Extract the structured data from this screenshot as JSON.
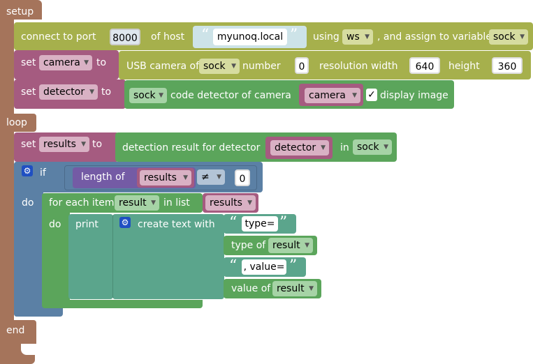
{
  "setup": {
    "label": "setup",
    "connect": {
      "prefix": "connect to port",
      "port": "8000",
      "of_host": "of host",
      "host": "myunoq.local",
      "using": "using",
      "protocol": "ws",
      "assign": ", and assign to variable",
      "variable": "sock"
    },
    "set_camera": {
      "set": "set",
      "var": "camera",
      "to": "to",
      "usb_camera_of": "USB camera of",
      "sock": "sock",
      "number": "number",
      "number_value": "0",
      "resolution_width": "resolution width",
      "width_value": "640",
      "height": "height",
      "height_value": "360"
    },
    "set_detector": {
      "set": "set",
      "var": "detector",
      "to": "to",
      "sock": "sock",
      "code_detector_of": "code detector of",
      "camera_label": "camera",
      "camera_var": "camera",
      "check": "✓",
      "display_image": "display image"
    }
  },
  "loop": {
    "label": "loop",
    "set_results": {
      "set": "set",
      "var": "results",
      "to": "to",
      "detection_label": "detection result for detector",
      "detector_var": "detector",
      "in": "in",
      "sock": "sock"
    },
    "if_block": {
      "if": "if",
      "do": "do",
      "length_of": "length of",
      "results_var": "results",
      "operator": "≠",
      "compare_value": "0"
    },
    "for_each": {
      "for_each_item": "for each item",
      "item_var": "result",
      "in_list": "in list",
      "list_var": "results",
      "do": "do"
    },
    "print_block": {
      "print": "print",
      "create_text_with": "create text with",
      "text1": "type=",
      "type_of": "type of",
      "type_var": "result",
      "text2": ", value=",
      "value_of": "value of",
      "value_var": "result"
    }
  },
  "end": {
    "label": "end"
  },
  "colors": {
    "hat": "#a5745b",
    "olive": "#a6b04c",
    "variable": "#a55b80",
    "green": "#5ba55b",
    "logic": "#5b80a5",
    "text": "#5ba58c",
    "listpurple": "#745ba5"
  }
}
